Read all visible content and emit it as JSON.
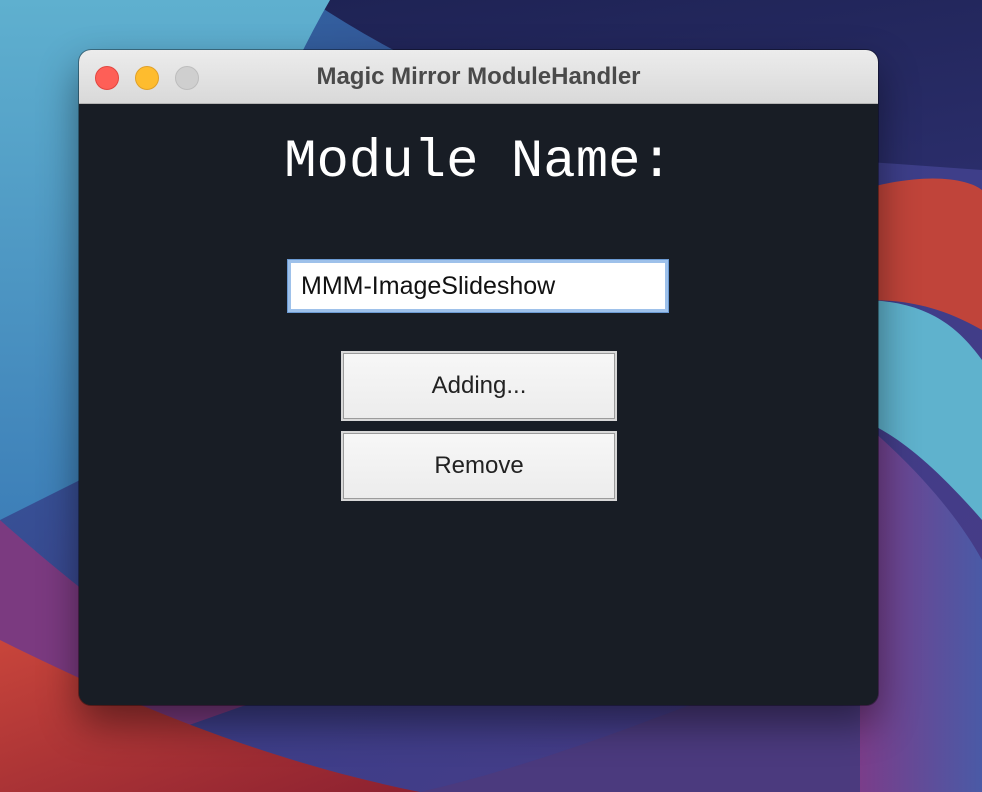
{
  "window": {
    "title": "Magic Mirror ModuleHandler"
  },
  "main": {
    "heading": "Module Name:",
    "module_input": {
      "value": "MMM-ImageSlideshow"
    },
    "add_button_label": "Adding...",
    "remove_button_label": "Remove"
  },
  "colors": {
    "window_background": "#181d25",
    "close": "#fe5f57",
    "minimize": "#febc2e",
    "zoom_inactive": "#cfcfcf",
    "input_focus_ring": "#9ec1ea"
  }
}
